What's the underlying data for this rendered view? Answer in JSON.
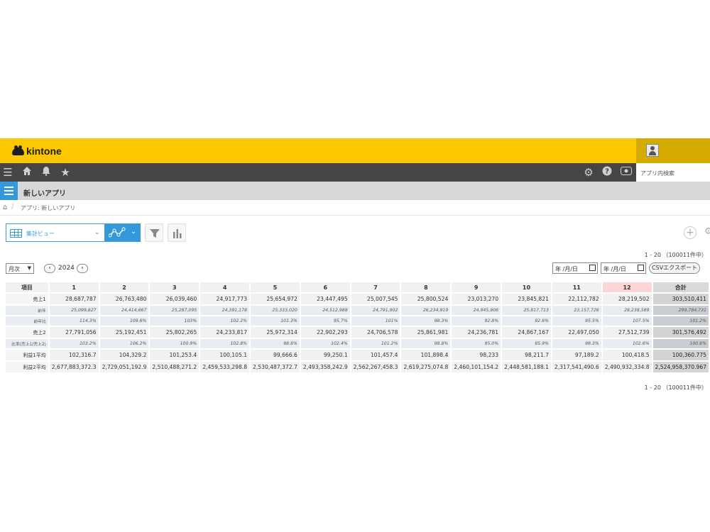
{
  "brand": "kintone",
  "search": {
    "placeholder": "アプリ内検索"
  },
  "app": {
    "name": "新しいアプリ"
  },
  "breadcrumb": {
    "label": "アプリ: 新しいアプリ"
  },
  "toolbar": {
    "view_label": "集計ビュー"
  },
  "pager": {
    "top": "1 - 20 （100011件中）",
    "bottom": "1 - 20 （100011件中）"
  },
  "controls": {
    "period": "月次",
    "prev": "‹",
    "next": "›",
    "year": "2024",
    "date_placeholder": "年 /月/日",
    "csv_label": "CSVエクスポート"
  },
  "colors": {
    "header": "#fcc800",
    "accent": "#3498db",
    "gnav": "#454545",
    "up": "#3b62d6",
    "down": "#e0504a"
  },
  "table": {
    "header": [
      "項目",
      "1",
      "2",
      "3",
      "4",
      "5",
      "6",
      "7",
      "8",
      "9",
      "10",
      "11",
      "12",
      "合計"
    ],
    "rows": [
      {
        "label": "売上1",
        "kind": "main",
        "cells": [
          "28,687,787",
          "26,763,480",
          "26,039,460",
          "24,917,773",
          "25,654,972",
          "23,447,495",
          "25,007,545",
          "25,800,524",
          "23,013,270",
          "23,845,821",
          "22,112,782",
          "28,219,502",
          "303,510,411"
        ]
      },
      {
        "label": "前年",
        "kind": "sub",
        "cells": [
          "25,099,827",
          "24,414,667",
          "25,287,095",
          "24,391,178",
          "25,333,020",
          "24,512,988",
          "24,791,902",
          "26,234,919",
          "24,945,906",
          "25,817,713",
          "23,157,726",
          "28,238,589",
          "299,784,731"
        ]
      },
      {
        "label": "前年比",
        "kind": "sub",
        "cells": [
          "114.3%",
          "109.6%",
          "103%",
          "102.2%",
          "101.3%",
          "95.7%",
          "101%",
          "98.3%",
          "92.8%",
          "92.6%",
          "95.5%",
          "107.5%",
          "101.2%"
        ],
        "trend": [
          "up",
          "up",
          "up",
          "up",
          "up",
          "down",
          "up",
          "down",
          "down",
          "down",
          "down",
          "up",
          "up"
        ]
      },
      {
        "label": "売上2",
        "kind": "main",
        "cells": [
          "27,791,056",
          "25,192,451",
          "25,802,265",
          "24,233,817",
          "25,972,314",
          "22,902,293",
          "24,706,578",
          "25,861,981",
          "24,236,781",
          "24,867,167",
          "22,497,050",
          "27,512,739",
          "301,576,492"
        ]
      },
      {
        "label": "比率(売上1/売上2)",
        "kind": "sub",
        "cells": [
          "103.2%",
          "106.2%",
          "100.9%",
          "102.8%",
          "98.8%",
          "102.4%",
          "101.2%",
          "99.8%",
          "95.0%",
          "95.9%",
          "98.3%",
          "102.6%",
          "100.6%"
        ],
        "trend": [
          "up",
          "up",
          "up",
          "up",
          "down",
          "up",
          "up",
          "down",
          "down",
          "down",
          "down",
          "up",
          "up"
        ]
      },
      {
        "label": "利益1平均",
        "kind": "main",
        "cells": [
          "102,316.7",
          "104,329.2",
          "101,253.4",
          "100,105.1",
          "99,666.6",
          "99,250.1",
          "101,457.4",
          "101,898.4",
          "98,233",
          "98,211.7",
          "97,189.2",
          "100,418.5",
          "100,360.775"
        ]
      },
      {
        "label": "利益2平均",
        "kind": "main",
        "cells": [
          "2,677,883,372.3",
          "2,729,051,192.9",
          "2,510,488,271.2",
          "2,459,533,298.8",
          "2,530,487,372.7",
          "2,493,358,242.9",
          "2,562,267,458.3",
          "2,619,275,074.8",
          "2,460,101,154.2",
          "2,448,581,188.1",
          "2,317,541,490.6",
          "2,490,932,334.8",
          "2,524,958,370.967"
        ]
      }
    ]
  }
}
